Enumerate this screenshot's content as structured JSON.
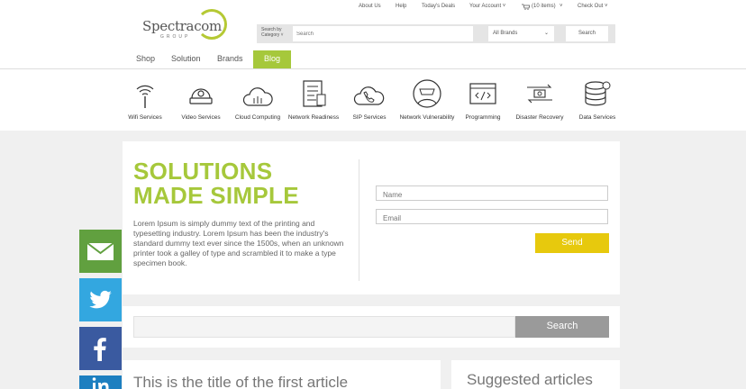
{
  "logo": {
    "name": "Spectracom",
    "sub": "GROUP"
  },
  "toplinks": [
    "About Us",
    "Help",
    "Today's Deals",
    "Your Account ˅",
    "(10 items)",
    "˅",
    "Check Out ˅"
  ],
  "search": {
    "category_label_1": "Search by",
    "category_label_2": "Category ˅",
    "placeholder": "Search",
    "brands": "All Brands",
    "button": "Search"
  },
  "nav": [
    "Shop",
    "Solution",
    "Brands",
    "Blog"
  ],
  "services": [
    {
      "label": "Wifi Services",
      "icon": "wifi-icon"
    },
    {
      "label": "Video Services",
      "icon": "camera-icon"
    },
    {
      "label": "Cloud Computing",
      "icon": "cloud-icon"
    },
    {
      "label": "Network Readiness",
      "icon": "document-icon"
    },
    {
      "label": "SIP Services",
      "icon": "phone-cloud-icon"
    },
    {
      "label": "Network Vulnerability",
      "icon": "hacker-icon"
    },
    {
      "label": "Programming",
      "icon": "code-icon"
    },
    {
      "label": "Disaster Recovery",
      "icon": "recovery-icon"
    },
    {
      "label": "Data Services",
      "icon": "database-icon"
    }
  ],
  "hero": {
    "title_line1": "SOLUTIONS",
    "title_line2": "MADE SIMPLE",
    "text": "Lorem Ipsum is simply dummy text of the printing and typesetting industry. Lorem Ipsum has been the industry's standard dummy text ever since the 1500s, when an unknown printer took a galley of type and scrambled it to make a type specimen book.",
    "name_placeholder": "Name",
    "email_placeholder": "Email",
    "send": "Send"
  },
  "blog_search": {
    "button": "Search"
  },
  "article": {
    "title": "This is the title of the first article"
  },
  "suggested": {
    "title": "Suggested articles"
  },
  "colors": {
    "accent": "#a6c83b",
    "send": "#e7c90d",
    "mail": "#61a03f",
    "twitter": "#33a7e0",
    "facebook": "#3a5aa0",
    "linkedin": "#1d7fc0"
  }
}
